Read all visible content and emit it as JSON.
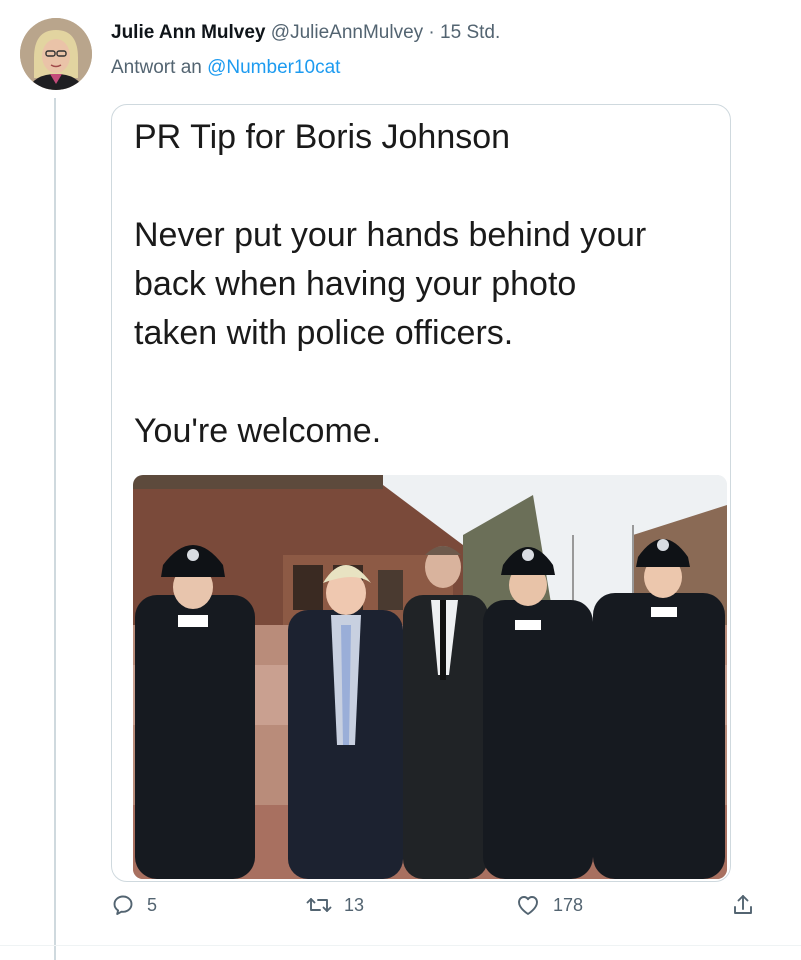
{
  "tweet": {
    "author_name": "Julie Ann Mulvey",
    "author_handle": "@JulieAnnMulvey",
    "separator": "·",
    "time": "15 Std.",
    "reply_prefix": "Antwort an",
    "reply_to": "@Number10cat"
  },
  "media": {
    "lines": [
      "PR Tip for Boris Johnson",
      "",
      "Never put your hands behind your",
      "back when having your photo",
      "taken with police officers.",
      "",
      "You're welcome."
    ]
  },
  "actions": {
    "replies": "5",
    "retweets": "13",
    "likes": "178"
  },
  "icons": {
    "reply": "reply-icon",
    "retweet": "retweet-icon",
    "like": "heart-icon",
    "share": "share-icon"
  },
  "colors": {
    "link": "#1d9bf0",
    "secondary": "#536471",
    "thread_line": "#cfd9de"
  }
}
